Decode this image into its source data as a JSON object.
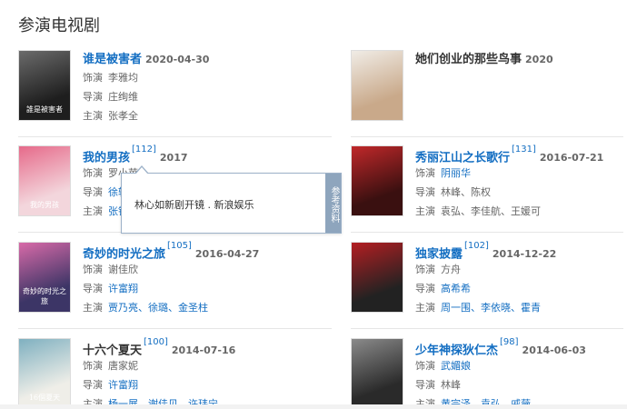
{
  "section_title": "参演电视剧",
  "labels": {
    "actor": "饰演",
    "director": "导演",
    "starring": "主演"
  },
  "items": [
    {
      "title": "谁是被害者",
      "ref": "",
      "date": "2020-04-30",
      "title_link": true,
      "role": "李雅均",
      "role_link": false,
      "director": "庄绚维",
      "director_link": false,
      "stars": [
        "张孝全"
      ],
      "stars_link": false,
      "poster": {
        "label": "誰是被害者",
        "bg": "#1e1e1e",
        "accent": "#6b6b6b"
      }
    },
    {
      "title": "她们创业的那些鸟事",
      "ref": "",
      "date": "2020",
      "title_link": false,
      "role": "",
      "director": "",
      "stars": [],
      "poster": {
        "label": "",
        "bg": "#c9a98a",
        "accent": "#f0ece6"
      }
    },
    {
      "title": "我的男孩",
      "ref": "[112]",
      "date": "2017",
      "title_link": true,
      "role": "罗小苹",
      "role_link": false,
      "director": "徐辅军",
      "director_link": true,
      "stars": [
        "张铭恩"
      ],
      "stars_link": true,
      "poster": {
        "label": "我的男孩",
        "bg": "#f3d6dc",
        "accent": "#e66a8a"
      }
    },
    {
      "title": "秀丽江山之长歌行",
      "ref": "[131]",
      "date": "2016-07-21",
      "title_link": true,
      "role": "阴丽华",
      "role_link": true,
      "director": "林峰、陈权",
      "director_link": false,
      "stars": [
        "袁弘、李佳航、王媛可"
      ],
      "stars_link": false,
      "poster": {
        "label": "",
        "bg": "#3a1010",
        "accent": "#c0282a"
      }
    },
    {
      "title": "奇妙的时光之旅",
      "ref": "[105]",
      "date": "2016-04-27",
      "title_link": true,
      "role": "谢佳欣",
      "role_link": false,
      "director": "许富翔",
      "director_link": true,
      "stars": [
        "贾乃亮、",
        "徐璐、",
        "金圣柱"
      ],
      "stars_link": true,
      "poster": {
        "label": "奇妙的时光之旅",
        "bg": "#3c3566",
        "accent": "#d86aa8"
      }
    },
    {
      "title": "独家披露",
      "ref": "[102]",
      "date": "2014-12-22",
      "title_link": true,
      "role": "方舟",
      "role_link": false,
      "director": "高希希",
      "director_link": true,
      "stars": [
        "周一围、",
        "李依晓、",
        "霍青"
      ],
      "stars_link": true,
      "poster": {
        "label": "",
        "bg": "#222",
        "accent": "#b31e22"
      }
    },
    {
      "title": "十六个夏天",
      "ref": "[100]",
      "date": "2014-07-16",
      "title_link": false,
      "role": "唐家妮",
      "role_link": false,
      "director": "许富翔",
      "director_link": true,
      "stars": [
        "杨一展、",
        "谢佳见、",
        "许玮宁"
      ],
      "stars_link": true,
      "poster": {
        "label": "16個夏天",
        "bg": "#efeee8",
        "accent": "#7fb0c0"
      }
    },
    {
      "title": "少年神探狄仁杰",
      "ref": "[98]",
      "date": "2014-06-03",
      "title_link": true,
      "role": "武媚娘",
      "role_link": true,
      "director": "林峰",
      "director_link": false,
      "stars": [
        "黄宗泽、",
        "袁弘、",
        "戚薇"
      ],
      "stars_link": true,
      "poster": {
        "label": "",
        "bg": "#2a2a2a",
        "accent": "#8a8a8a"
      }
    }
  ],
  "tooltip": {
    "text": "林心如新剧开镜 . 新浪娱乐",
    "side_label": "参考资料"
  }
}
